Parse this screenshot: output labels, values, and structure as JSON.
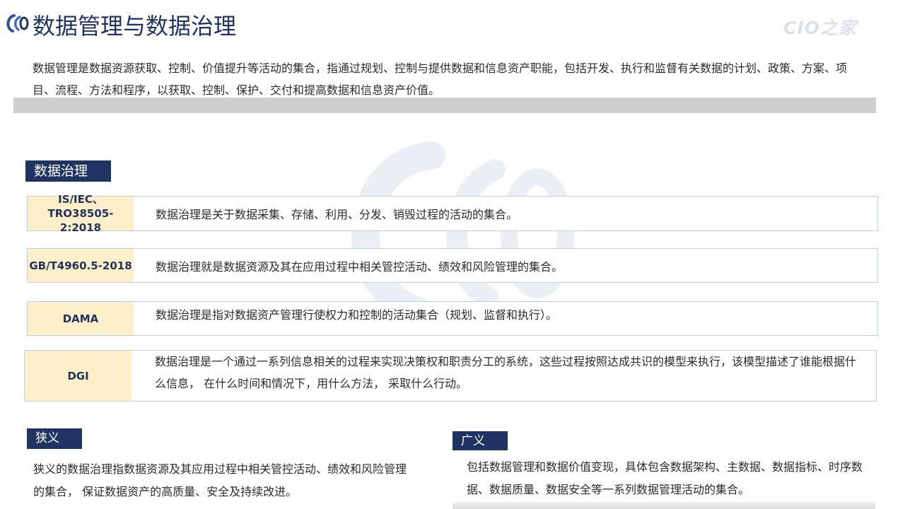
{
  "header": {
    "title": "数据管理与数据治理",
    "brand": "CIO之家"
  },
  "intro": {
    "text": "数据管理是数据资源获取、控制、价值提升等活动的集合，指通过规划、控制与提供数据和信息资产职能，包括开发、执行和监督有关数据的计划、政策、方案、项目、流程、方法和程序，以获取、控制、保护、交付和提高数据和信息资产价值。"
  },
  "governance": {
    "label": "数据治理",
    "definitions": [
      {
        "source": "IS/IEC、TRO38505-2:2018",
        "text": "数据治理是关于数据采集、存储、利用、分发、销毁过程的活动的集合。"
      },
      {
        "source": "GB/T4960.5-2018",
        "text": "数据治理就是数据资源及其在应用过程中相关管控活动、绩效和风险管理的集合。"
      },
      {
        "source": "DAMA",
        "text": "数据治理是指对数据资产管理行使权力和控制的活动集合（规划、监督和执行）。"
      },
      {
        "source": "DGI",
        "text": "数据治理是一个通过一系列信息相关的过程来实现决策权和职责分工的系统，这些过程按照达成共识的模型来执行，该模型描述了谁能根据什么信息， 在什么时间和情况下，用什么方法， 采取什么行动。"
      }
    ]
  },
  "narrow": {
    "label": "狭义",
    "text": "狭义的数据治理指数据资源及其应用过程中相关管控活动、绩效和风险管理的集合， 保证数据资产的高质量、安全及持续改进。"
  },
  "broad": {
    "label": "广义",
    "text": "包括数据管理和数据价值变现，具体包含数据架构、主数据、数据指标、时序数据、数据质量、数据安全等一系列数据管理活动的集合。"
  },
  "colors": {
    "navy": "#1f3462",
    "source_bg": "#fcefc9",
    "row_border": "#b8cfe6",
    "band": "#cfcfcf"
  }
}
